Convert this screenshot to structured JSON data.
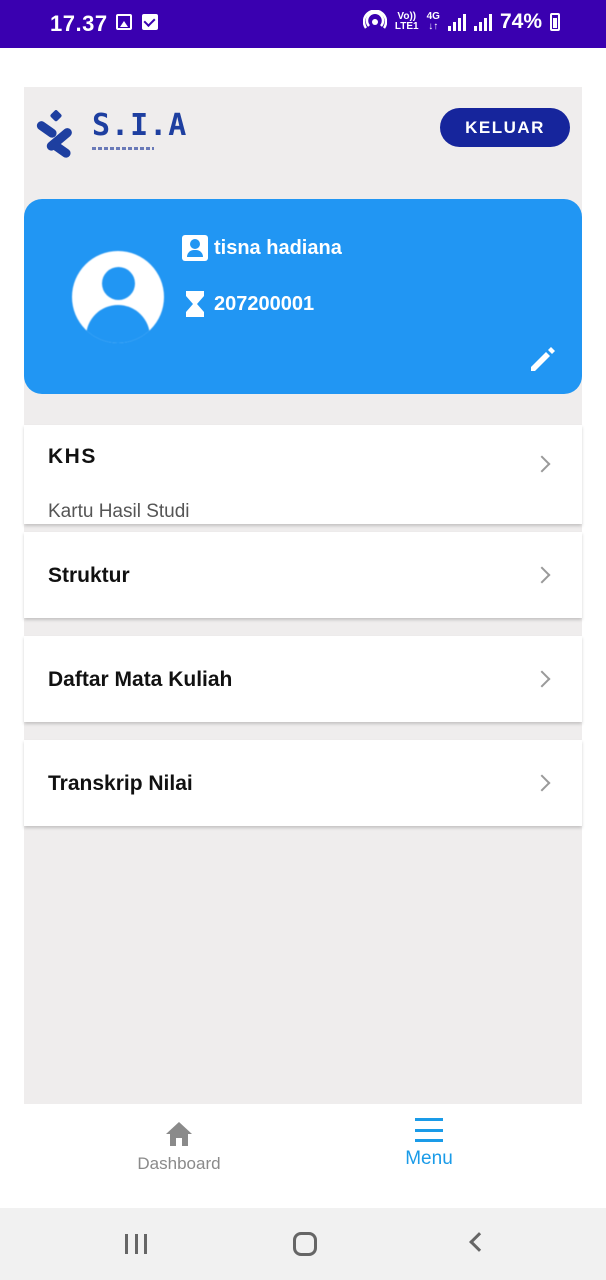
{
  "status_bar": {
    "time": "17.37",
    "network_top": "Vo))",
    "network_bottom": "LTE1",
    "net_type_top": "4G",
    "net_type_bottom": "↓↑",
    "battery": "74%"
  },
  "header": {
    "logo_text": "S.I.A",
    "logout_label": "KELUAR"
  },
  "profile": {
    "name": "tisna hadiana",
    "nim": "207200001"
  },
  "menu": [
    {
      "title": "KHS",
      "subtitle": "Kartu Hasil Studi"
    },
    {
      "title": "Struktur"
    },
    {
      "title": "Daftar Mata Kuliah"
    },
    {
      "title": "Transkrip Nilai"
    }
  ],
  "bottom_nav": {
    "dashboard_label": "Dashboard",
    "menu_label": "Menu",
    "active": "Menu",
    "active_color": "#1a9be8",
    "inactive_color": "#8a8a8a"
  },
  "colors": {
    "status_bar": "#3a00b0",
    "profile_card": "#2196f3",
    "logout_button": "#16259c",
    "background": "#efeded"
  }
}
